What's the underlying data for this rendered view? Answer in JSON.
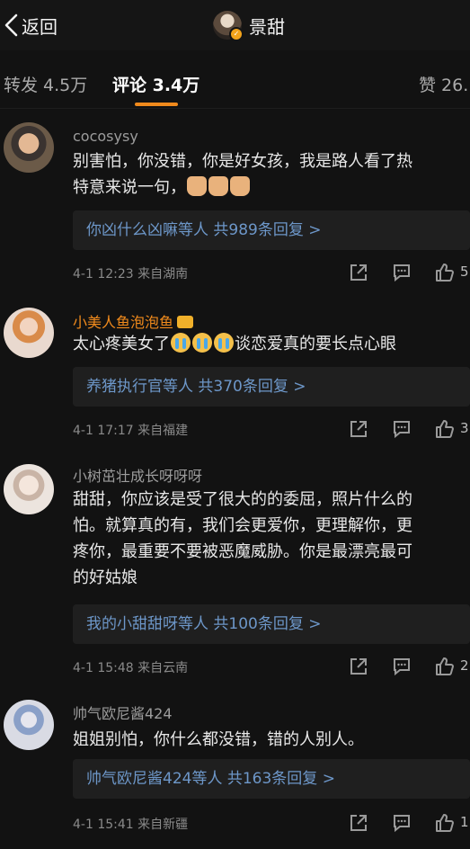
{
  "header": {
    "back_label": "返回",
    "title": "景甜"
  },
  "tabs": [
    {
      "label": "转发 4.5万"
    },
    {
      "label": "评论 3.4万"
    },
    {
      "label": "赞 26."
    }
  ],
  "comments": [
    {
      "username": "cocosysy",
      "text": "别害怕，你没错，你是好女孩，我是路人看了热\n特意来说一句，",
      "reply_summary": "你凶什么凶嘛等人 共989条回复 >",
      "date": "4-1 12:23",
      "location": "来自湖南",
      "likes": "5"
    },
    {
      "username": "小美人鱼泡泡鱼",
      "text_before": "太心疼美女了",
      "text_after": "谈恋爱真的要长点心眼",
      "reply_summary": "养猪执行官等人 共370条回复 >",
      "date": "4-1 17:17",
      "location": "来自福建",
      "likes": "3"
    },
    {
      "username": "小树茁壮成长呀呀呀",
      "text": "甜甜，你应该是受了很大的的委屈，照片什么的\n怕。就算真的有，我们会更爱你，更理解你，更\n疼你，最重要不要被恶魔威胁。你是最漂亮最可\n的好姑娘",
      "reply_summary": "我的小甜甜呀等人 共100条回复 >",
      "date": "4-1 15:48",
      "location": "来自云南",
      "likes": "2"
    },
    {
      "username": "帅气欧尼酱424",
      "text": "姐姐别怕，你什么都没错，错的人别人。",
      "reply_summary": "帅气欧尼酱424等人 共163条回复 >",
      "date": "4-1 15:41",
      "location": "来自新疆",
      "likes": "1"
    }
  ]
}
